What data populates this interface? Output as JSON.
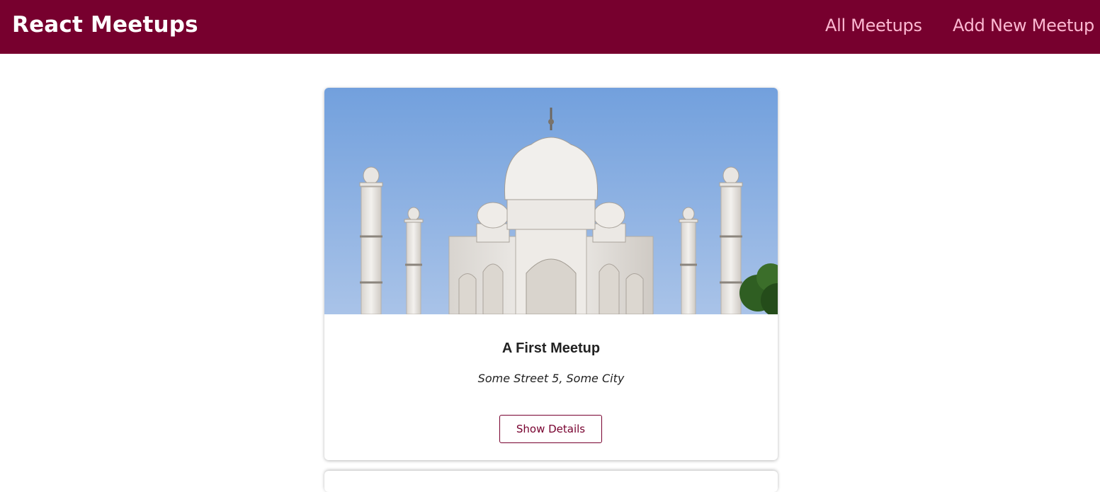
{
  "header": {
    "logo": "React Meetups",
    "nav": [
      {
        "label": "All Meetups"
      },
      {
        "label": "Add New Meetup"
      }
    ]
  },
  "meetups": [
    {
      "title": "A First Meetup",
      "address": "Some Street 5, Some City",
      "button_label": "Show Details"
    }
  ],
  "colors": {
    "header_bg": "#77002e",
    "nav_text": "#fcb8d2",
    "sky": "#7ba3d9"
  }
}
